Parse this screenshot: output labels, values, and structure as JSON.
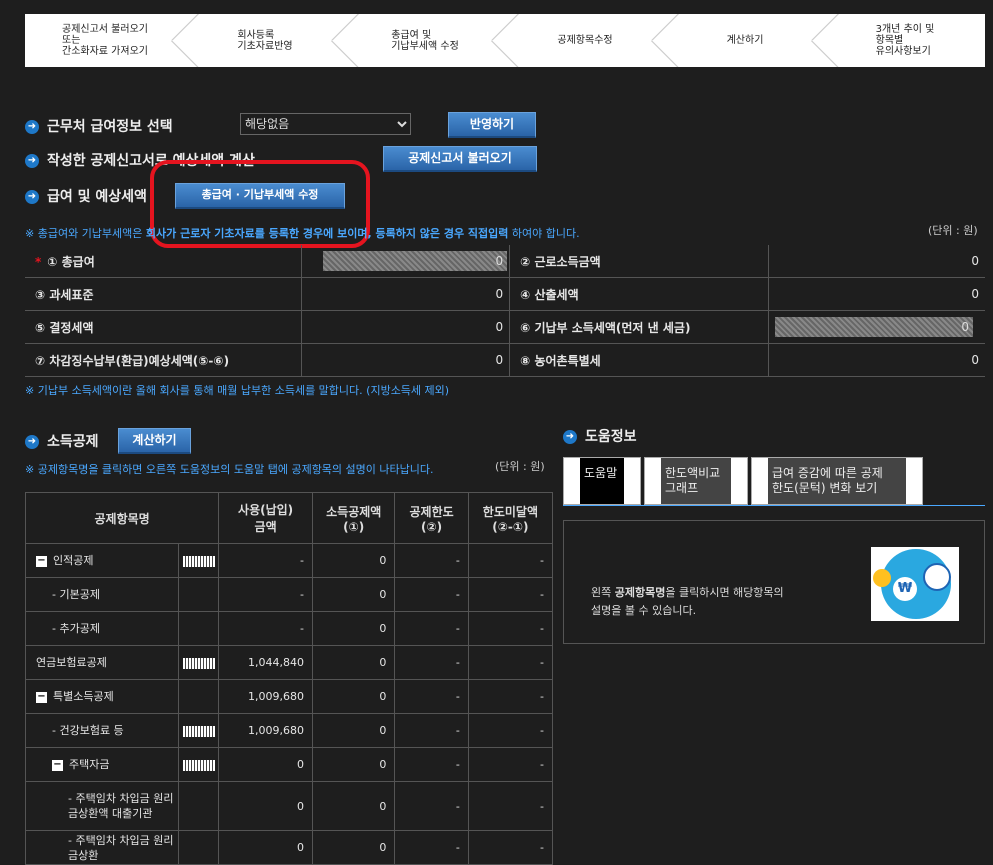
{
  "steps": [
    "공제신고서 불러오기\n또는\n간소화자료 가져오기",
    "회사등록\n기초자료반영",
    "총급여 및\n기납부세액 수정",
    "공제항목수정",
    "계산하기",
    "3개년 추이 및\n항목별\n유의사항보기"
  ],
  "sections": {
    "s1": "근무처 급여정보 선택",
    "s2": "작성한 공제신고서로 예상세액 계산",
    "s3": "급여 및 예상세액",
    "select_value": "해당없음",
    "apply_btn": "반영하기",
    "load_btn": "공제신고서 불러오기",
    "edit_btn": "총급여 · 기납부세액 수정"
  },
  "note1_pre": "※ 총급여와 기납부세액은 ",
  "note1_bold": "회사가 근로자 기초자료를 등록한 경우에 보이며, 등록하지 않은 경우 직접입력",
  "note1_post": " 하여야 합니다.",
  "unit": "(단위 : 원)",
  "tax_rows": [
    {
      "l1": "① 총급여",
      "v1": "0",
      "l2": "② 근로소득금액",
      "v2": "0"
    },
    {
      "l1": "③ 과세표준",
      "v1": "0",
      "l2": "④ 산출세액",
      "v2": "0"
    },
    {
      "l1": "⑤ 결정세액",
      "v1": "0",
      "l2": "⑥ 기납부 소득세액(먼저 낸 세금)",
      "v2": "0"
    },
    {
      "l1": "⑦ 차감징수납부(환급)예상세액(⑤-⑥)",
      "v1": "0",
      "l2": "⑧ 농어촌특별세",
      "v2": "0"
    }
  ],
  "star": "*",
  "note2": "※ 기납부 소득세액이란 올해 회사를 통해 매월 납부한 소득세를 말합니다. (지방소득세 제외)",
  "deduct": {
    "title": "소득공제",
    "calc_btn": "계산하기",
    "note": "※ 공제항목명을 클릭하면 오른쪽 도움정보의 도움말 탭에 공제항목의 설명이 나타납니다.",
    "unit": "(단위 : 원)",
    "headers": [
      "공제항목명",
      "사용(납입)\n금액",
      "소득공제액\n(①)",
      "공제한도\n(②)",
      "한도미달액\n(②-①)"
    ],
    "rows": [
      {
        "name": "인적공제",
        "indent": 0,
        "minus": true,
        "calc": true,
        "use": "-",
        "ded": "0",
        "lim": "-",
        "under": "-"
      },
      {
        "name": "- 기본공제",
        "indent": 1,
        "minus": false,
        "calc": false,
        "use": "-",
        "ded": "0",
        "lim": "-",
        "under": "-"
      },
      {
        "name": "- 추가공제",
        "indent": 1,
        "minus": false,
        "calc": false,
        "use": "-",
        "ded": "0",
        "lim": "-",
        "under": "-"
      },
      {
        "name": "연금보험료공제",
        "indent": 0,
        "minus": false,
        "calc": true,
        "use": "1,044,840",
        "ded": "0",
        "lim": "-",
        "under": "-"
      },
      {
        "name": "특별소득공제",
        "indent": 0,
        "minus": true,
        "calc": false,
        "use": "1,009,680",
        "ded": "0",
        "lim": "-",
        "under": "-"
      },
      {
        "name": "- 건강보험료 등",
        "indent": 1,
        "minus": false,
        "calc": true,
        "use": "1,009,680",
        "ded": "0",
        "lim": "-",
        "under": "-"
      },
      {
        "name": "주택자금",
        "indent": 1,
        "minus": true,
        "calc": true,
        "use": "0",
        "ded": "0",
        "lim": "-",
        "under": "-"
      },
      {
        "name": "- 주택임차 차입금 원리금상환액 대출기관",
        "indent": 2,
        "minus": false,
        "calc": false,
        "use": "0",
        "ded": "0",
        "lim": "-",
        "under": "-"
      },
      {
        "name": "- 주택임차 차입금 원리금상환",
        "indent": 2,
        "minus": false,
        "calc": false,
        "use": "0",
        "ded": "0",
        "lim": "-",
        "under": "-"
      }
    ]
  },
  "help": {
    "title": "도움정보",
    "tabs": [
      "도움말",
      "한도액비교\n그래프",
      "급여 증감에 따른 공제\n한도(문턱) 변화 보기"
    ],
    "text_pre": "왼쪽 ",
    "text_bold": "공제항목명",
    "text_post": "을 클릭하시면 해당항목의\n설명을 볼 수 있습니다.",
    "won": "₩"
  }
}
